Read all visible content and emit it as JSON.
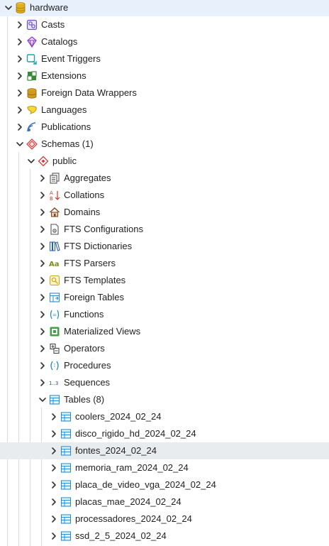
{
  "tree": {
    "rows": [
      {
        "label": "hardware",
        "icon": "database-icon",
        "expanded": true,
        "selected": true
      },
      {
        "label": "Casts",
        "icon": "casts-icon",
        "expanded": false
      },
      {
        "label": "Catalogs",
        "icon": "catalogs-icon",
        "expanded": false
      },
      {
        "label": "Event Triggers",
        "icon": "event-triggers-icon",
        "expanded": false
      },
      {
        "label": "Extensions",
        "icon": "extensions-icon",
        "expanded": false
      },
      {
        "label": "Foreign Data Wrappers",
        "icon": "foreign-data-wrappers-icon",
        "expanded": false
      },
      {
        "label": "Languages",
        "icon": "languages-icon",
        "expanded": false
      },
      {
        "label": "Publications",
        "icon": "publications-icon",
        "expanded": false
      },
      {
        "label": "Schemas (1)",
        "icon": "schemas-icon",
        "expanded": true
      },
      {
        "label": "public",
        "icon": "schema-icon",
        "expanded": true
      },
      {
        "label": "Aggregates",
        "icon": "aggregates-icon",
        "expanded": false
      },
      {
        "label": "Collations",
        "icon": "collations-icon",
        "expanded": false
      },
      {
        "label": "Domains",
        "icon": "domains-icon",
        "expanded": false
      },
      {
        "label": "FTS Configurations",
        "icon": "fts-configurations-icon",
        "expanded": false
      },
      {
        "label": "FTS Dictionaries",
        "icon": "fts-dictionaries-icon",
        "expanded": false
      },
      {
        "label": "FTS Parsers",
        "icon": "fts-parsers-icon",
        "icon_text": "Aa",
        "expanded": false
      },
      {
        "label": "FTS Templates",
        "icon": "fts-templates-icon",
        "expanded": false
      },
      {
        "label": "Foreign Tables",
        "icon": "foreign-tables-icon",
        "expanded": false
      },
      {
        "label": "Functions",
        "icon": "functions-icon",
        "expanded": false
      },
      {
        "label": "Materialized Views",
        "icon": "materialized-views-icon",
        "expanded": false
      },
      {
        "label": "Operators",
        "icon": "operators-icon",
        "expanded": false
      },
      {
        "label": "Procedures",
        "icon": "procedures-icon",
        "expanded": false
      },
      {
        "label": "Sequences",
        "icon": "sequences-icon",
        "icon_text": "1..3",
        "expanded": false
      },
      {
        "label": "Tables (8)",
        "icon": "tables-icon",
        "expanded": true
      },
      {
        "label": "coolers_2024_02_24",
        "icon": "table-icon",
        "expanded": false
      },
      {
        "label": "disco_rigido_hd_2024_02_24",
        "icon": "table-icon",
        "expanded": false
      },
      {
        "label": "fontes_2024_02_24",
        "icon": "table-icon",
        "expanded": false,
        "hovered": true
      },
      {
        "label": "memoria_ram_2024_02_24",
        "icon": "table-icon",
        "expanded": false
      },
      {
        "label": "placa_de_video_vga_2024_02_24",
        "icon": "table-icon",
        "expanded": false
      },
      {
        "label": "placas_mae_2024_02_24",
        "icon": "table-icon",
        "expanded": false
      },
      {
        "label": "processadores_2024_02_24",
        "icon": "table-icon",
        "expanded": false
      },
      {
        "label": "ssd_2_5_2024_02_24",
        "icon": "table-icon",
        "expanded": false
      }
    ]
  },
  "colors": {
    "selected_row": "#e8f1fb",
    "hovered_row": "#e9ecef",
    "caret": "#333333",
    "table_icon": "#2e8ac9",
    "guide_line": "#dcdcdc"
  }
}
